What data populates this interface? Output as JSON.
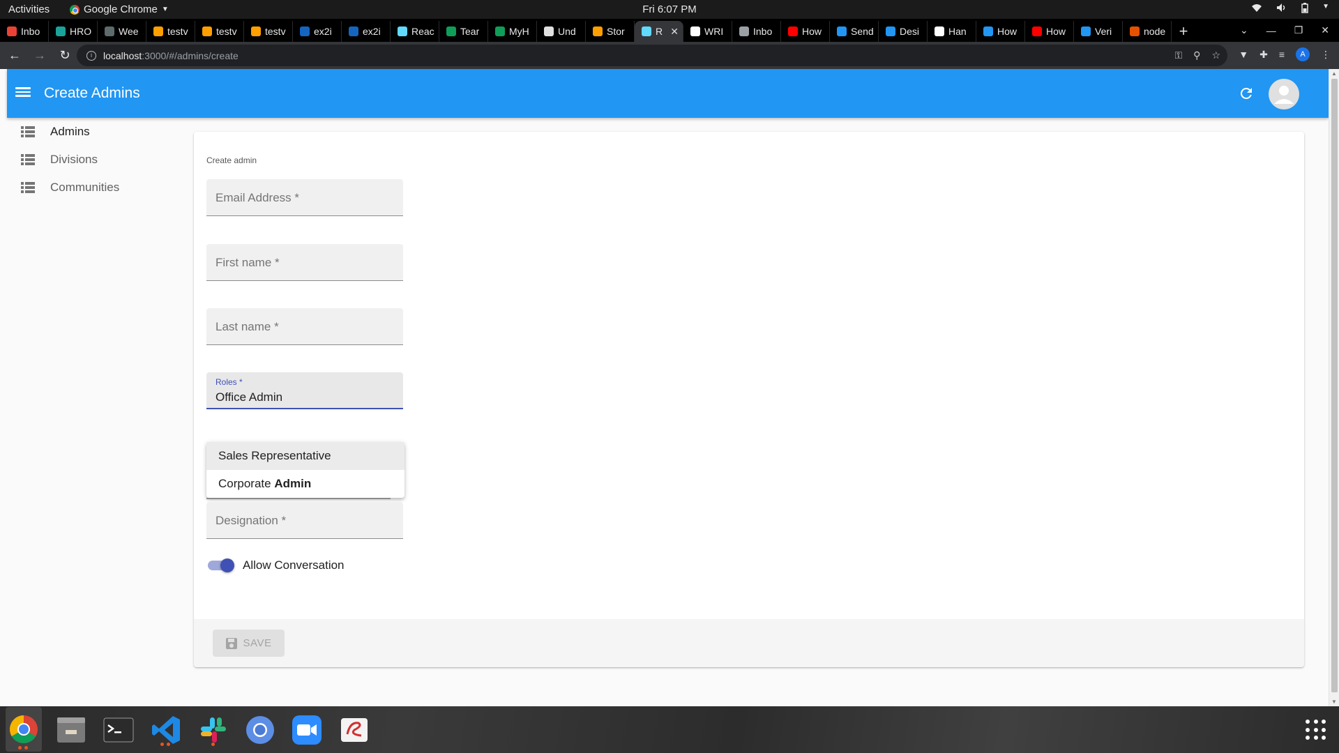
{
  "system_bar": {
    "activities": "Activities",
    "app_name": "Google Chrome",
    "clock": "Fri  6:07 PM"
  },
  "browser": {
    "tabs": [
      {
        "label": "Inbo",
        "icon": "gmail-icon",
        "color": "#ea4335"
      },
      {
        "label": "HRO",
        "icon": "hro-icon",
        "color": "#1aa39a"
      },
      {
        "label": "Wee",
        "icon": "openai-icon",
        "color": "#5c6b6b"
      },
      {
        "label": "testv",
        "icon": "firebase-icon",
        "color": "#ffa000"
      },
      {
        "label": "testv",
        "icon": "firebase-icon",
        "color": "#ffa000"
      },
      {
        "label": "testv",
        "icon": "firebase-icon",
        "color": "#ffa000"
      },
      {
        "label": "ex2i",
        "icon": "azure-icon",
        "color": "#1565c0"
      },
      {
        "label": "ex2i",
        "icon": "azure-icon",
        "color": "#1565c0"
      },
      {
        "label": "Reac",
        "icon": "react-icon",
        "color": "#61dafb"
      },
      {
        "label": "Tear",
        "icon": "sheets-icon",
        "color": "#0f9d58"
      },
      {
        "label": "MyH",
        "icon": "sheets-icon",
        "color": "#0f9d58"
      },
      {
        "label": "Und",
        "icon": "alien-icon",
        "color": "#e0e0e0"
      },
      {
        "label": "Stor",
        "icon": "firebase-icon",
        "color": "#ffa000"
      },
      {
        "label": "R",
        "icon": "react-icon",
        "color": "#61dafb",
        "active": true
      },
      {
        "label": "WRI",
        "icon": "globe-icon",
        "color": "#ffffff"
      },
      {
        "label": "Inbo",
        "icon": "y-icon",
        "color": "#9aa0a6"
      },
      {
        "label": "How",
        "icon": "youtube-icon",
        "color": "#ff0000"
      },
      {
        "label": "Send",
        "icon": "puzzle-icon",
        "color": "#2196f3"
      },
      {
        "label": "Desi",
        "icon": "puzzle-icon",
        "color": "#2196f3"
      },
      {
        "label": "Han",
        "icon": "globe-icon",
        "color": "#ffffff"
      },
      {
        "label": "How",
        "icon": "puzzle-icon",
        "color": "#2196f3"
      },
      {
        "label": "How",
        "icon": "youtube-icon",
        "color": "#ff0000"
      },
      {
        "label": "Veri",
        "icon": "puzzle-icon",
        "color": "#2196f3"
      },
      {
        "label": "node",
        "icon": "node-icon",
        "color": "#e65100"
      }
    ],
    "url_host": "localhost",
    "url_path": ":3000/#/admins/create",
    "profile_initial": "A"
  },
  "app": {
    "title": "Create Admins",
    "primary_color": "#2196f3",
    "accent_color": "#3f51b5",
    "sidebar": [
      {
        "label": "Admins",
        "active": true
      },
      {
        "label": "Divisions",
        "active": false
      },
      {
        "label": "Communities",
        "active": false
      }
    ],
    "form": {
      "caption": "Create admin",
      "email_label": "Email Address *",
      "first_name_label": "First name *",
      "last_name_label": "Last name *",
      "roles_label": "Roles *",
      "roles_value": "Office Admin",
      "designation_label": "Designation *",
      "allow_conversation_label": "Allow Conversation",
      "allow_conversation_on": true,
      "save_label": "SAVE"
    },
    "roles_options": [
      {
        "prefix": "Sales Representative",
        "match": ""
      },
      {
        "prefix": "Corporate ",
        "match": "Admin"
      }
    ]
  },
  "dock": {
    "items": [
      "chrome-icon",
      "files-icon",
      "terminal-icon",
      "vscode-icon",
      "slack-icon",
      "chromium-icon",
      "zoom-icon",
      "edge-like-icon"
    ]
  }
}
